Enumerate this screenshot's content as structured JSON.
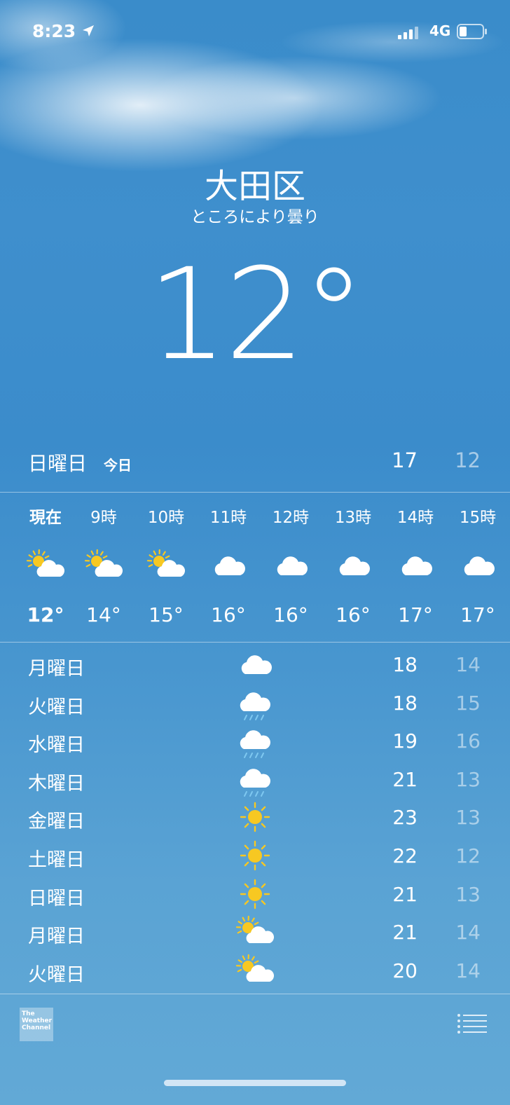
{
  "status_bar": {
    "time": "8:23",
    "network": "4G"
  },
  "location": {
    "city": "大田区",
    "condition": "ところにより曇り",
    "temperature": "12°"
  },
  "today": {
    "day": "日曜日",
    "tag": "今日",
    "high": "17",
    "low": "12"
  },
  "hourly": [
    {
      "time": "現在",
      "icon": "partly-cloudy-icon",
      "temp": "12°",
      "now": true
    },
    {
      "time": "9時",
      "icon": "partly-cloudy-icon",
      "temp": "14°"
    },
    {
      "time": "10時",
      "icon": "partly-cloudy-icon",
      "temp": "15°"
    },
    {
      "time": "11時",
      "icon": "cloud-icon",
      "temp": "16°"
    },
    {
      "time": "12時",
      "icon": "cloud-icon",
      "temp": "16°"
    },
    {
      "time": "13時",
      "icon": "cloud-icon",
      "temp": "16°"
    },
    {
      "time": "14時",
      "icon": "cloud-icon",
      "temp": "17°"
    },
    {
      "time": "15時",
      "icon": "cloud-icon",
      "temp": "17°"
    }
  ],
  "daily": [
    {
      "day": "月曜日",
      "icon": "cloud-icon",
      "high": "18",
      "low": "14"
    },
    {
      "day": "火曜日",
      "icon": "rain-icon",
      "high": "18",
      "low": "15"
    },
    {
      "day": "水曜日",
      "icon": "rain-icon",
      "high": "19",
      "low": "16"
    },
    {
      "day": "木曜日",
      "icon": "rain-icon",
      "high": "21",
      "low": "13"
    },
    {
      "day": "金曜日",
      "icon": "sun-icon",
      "high": "23",
      "low": "13"
    },
    {
      "day": "土曜日",
      "icon": "sun-icon",
      "high": "22",
      "low": "12"
    },
    {
      "day": "日曜日",
      "icon": "sun-icon",
      "high": "21",
      "low": "13"
    },
    {
      "day": "月曜日",
      "icon": "partly-cloudy-icon",
      "high": "21",
      "low": "14"
    },
    {
      "day": "火曜日",
      "icon": "partly-cloudy-icon",
      "high": "20",
      "low": "14"
    }
  ],
  "footer": {
    "provider_logo": "The Weather Channel"
  },
  "colors": {
    "sky": "#3f8fcd",
    "sun": "#f7c822",
    "rain": "#7ec8f0",
    "text": "#ffffff"
  }
}
